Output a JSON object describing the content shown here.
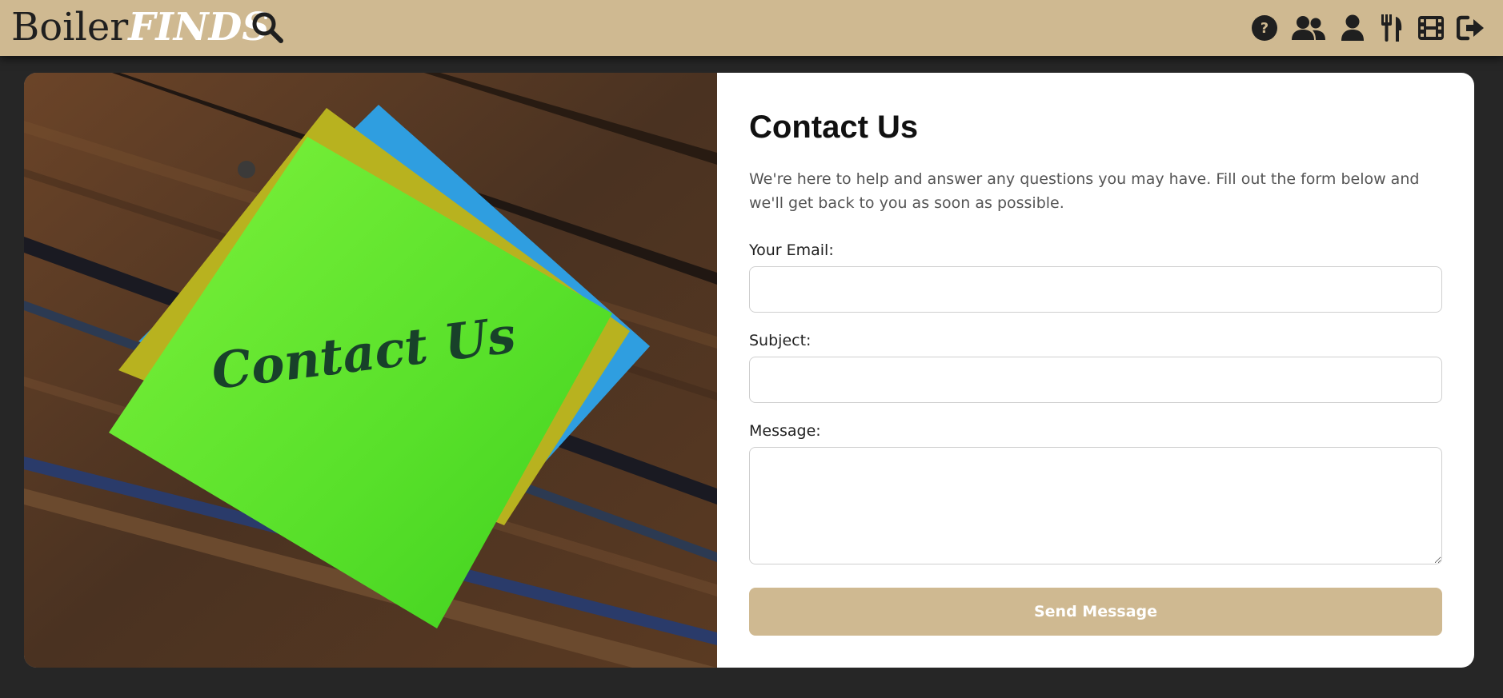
{
  "header": {
    "logo_left": "Boiler",
    "logo_right": "FINDS",
    "icons": [
      "search-icon",
      "help-icon",
      "users-icon",
      "user-icon",
      "utensils-icon",
      "film-icon",
      "logout-icon"
    ]
  },
  "hero": {
    "note_text": "Contact Us"
  },
  "form": {
    "title": "Contact Us",
    "description": "We're here to help and answer any questions you may have. Fill out the form below and we'll get back to you as soon as possible.",
    "email_label": "Your Email:",
    "email_value": "",
    "subject_label": "Subject:",
    "subject_value": "",
    "message_label": "Message:",
    "message_value": "",
    "submit_label": "Send Message"
  },
  "colors": {
    "brand": "#cfb991",
    "background": "#262626",
    "card": "#ffffff"
  }
}
